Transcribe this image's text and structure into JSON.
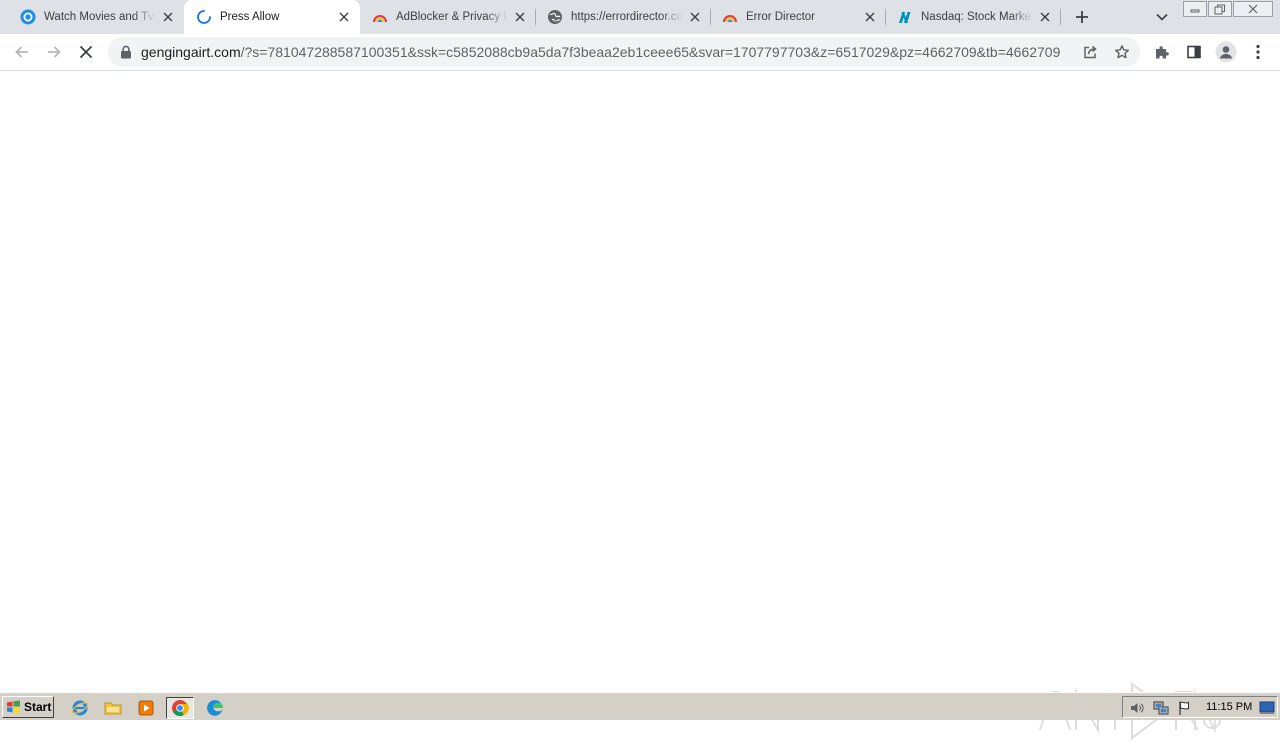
{
  "browser": {
    "tabs": [
      {
        "title": "Watch Movies and Tv Shows",
        "favicon": "circle-play-icon",
        "active": false
      },
      {
        "title": "Press Allow",
        "favicon": "loading-spinner-icon",
        "active": true
      },
      {
        "title": "AdBlocker & Privacy Protection",
        "favicon": "rainbow-icon",
        "active": false
      },
      {
        "title": "https://errordirector.com",
        "favicon": "globe-icon",
        "active": false
      },
      {
        "title": "Error Director",
        "favicon": "rainbow-icon",
        "active": false
      },
      {
        "title": "Nasdaq: Stock Market, Data",
        "favicon": "nasdaq-logo-icon",
        "active": false
      }
    ],
    "address": {
      "host": "gengingairt.com",
      "path": "/?s=781047288587100351&ssk=c5852088cb9a5da7f3beaa2eb1ceee65&svar=1707797703&z=6517029&pz=4662709&tb=4662709"
    },
    "colors": {
      "tab_strip": "#dee1e6",
      "omnibox": "#f1f3f4",
      "icon": "#5f6368"
    }
  },
  "taskbar": {
    "start_label": "Start",
    "clock": "11:15 PM"
  }
}
